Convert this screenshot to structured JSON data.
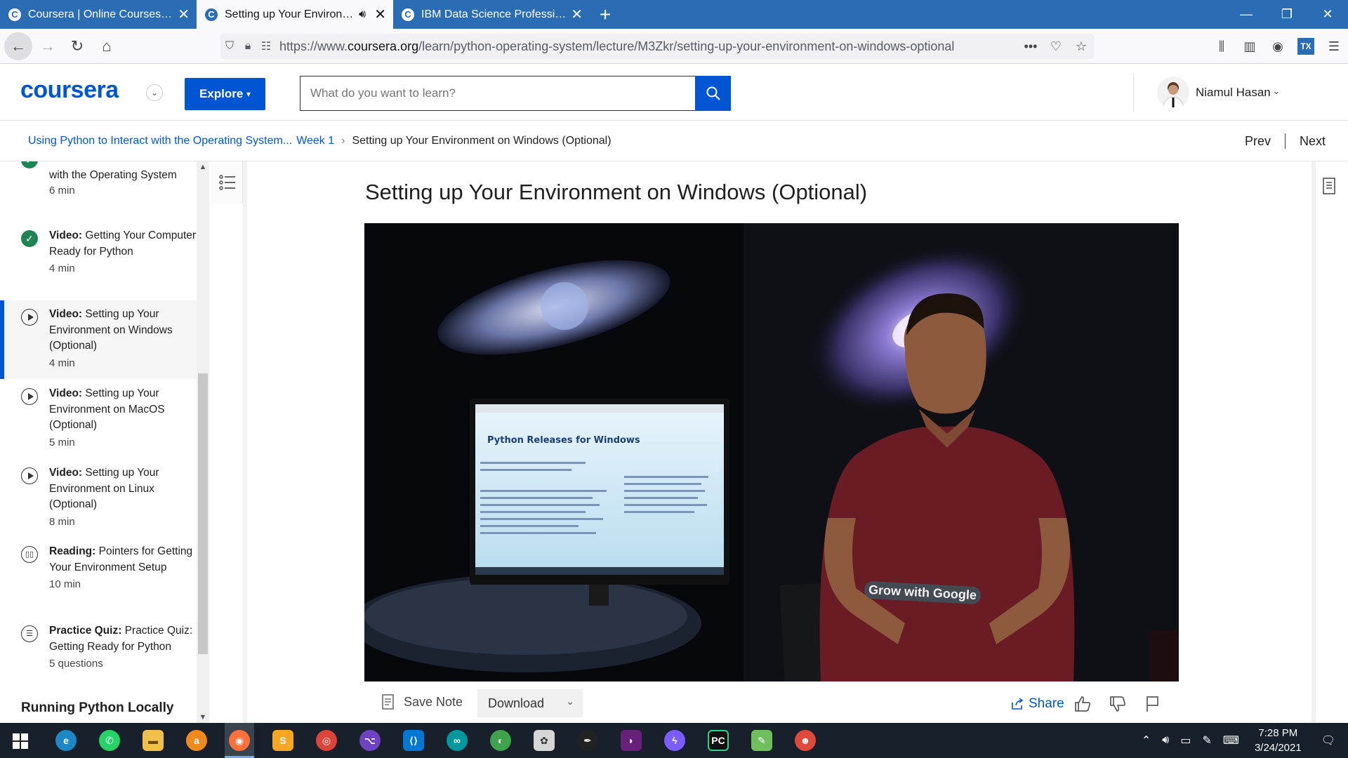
{
  "browser": {
    "tabs": [
      {
        "title": "Coursera | Online Courses & Cre",
        "active": false
      },
      {
        "title": "Setting up Your Environmen",
        "active": true
      },
      {
        "title": "IBM Data Science Professional",
        "active": false
      }
    ],
    "url_prefix": "https://www.",
    "url_domain": "coursera.org",
    "url_path": "/learn/python-operating-system/lecture/M3Zkr/setting-up-your-environment-on-windows-optional",
    "tab_accent": "#2a6db5"
  },
  "header": {
    "logo": "coursera",
    "explore_label": "Explore",
    "search_placeholder": "What do you want to learn?",
    "user_name": "Niamul Hasan",
    "brand_color": "#0056d2"
  },
  "breadcrumb": {
    "course": "Using Python to Interact with the Operating System...",
    "week": "Week 1",
    "current": "Setting up Your Environment on Windows (Optional)",
    "prev_label": "Prev",
    "next_label": "Next"
  },
  "sidebar": {
    "items": [
      {
        "type": "",
        "title": "with the Operating System",
        "duration": "6 min",
        "status": "done"
      },
      {
        "type": "Video:",
        "title": "Getting Your Computer Ready for Python",
        "duration": "4 min",
        "status": "done"
      },
      {
        "type": "Video:",
        "title": "Setting up Your Environment on Windows (Optional)",
        "duration": "4 min",
        "status": "current"
      },
      {
        "type": "Video:",
        "title": "Setting up Your Environment on MacOS (Optional)",
        "duration": "5 min",
        "status": "video"
      },
      {
        "type": "Video:",
        "title": "Setting up Your Environment on Linux (Optional)",
        "duration": "8 min",
        "status": "video"
      },
      {
        "type": "Reading:",
        "title": "Pointers for Getting Your Environment Setup",
        "duration": "10 min",
        "status": "reading"
      },
      {
        "type": "Practice Quiz:",
        "title": "Practice Quiz: Getting Ready for Python",
        "duration": "5 questions",
        "status": "quiz"
      }
    ],
    "next_section": "Running Python Locally"
  },
  "lecture": {
    "title": "Setting up Your Environment on Windows (Optional)",
    "video_screen_title": "Python Releases for Windows",
    "video_sticker": "Grow with Google",
    "save_note_label": "Save Note",
    "download_label": "Download",
    "share_label": "Share"
  },
  "taskbar": {
    "time": "7:28 PM",
    "date": "3/24/2021",
    "apps": [
      "edge-icon",
      "whatsapp-icon",
      "file-explorer-icon",
      "avast-icon",
      "firefox-icon",
      "sublime-icon",
      "chrome-icon",
      "github-icon",
      "vscode-icon",
      "arduino-icon",
      "earth-icon",
      "paint-icon",
      "inkscape-icon",
      "visual-studio-icon",
      "messenger-icon",
      "pycharm-icon",
      "notepad-icon",
      "game-icon"
    ]
  }
}
